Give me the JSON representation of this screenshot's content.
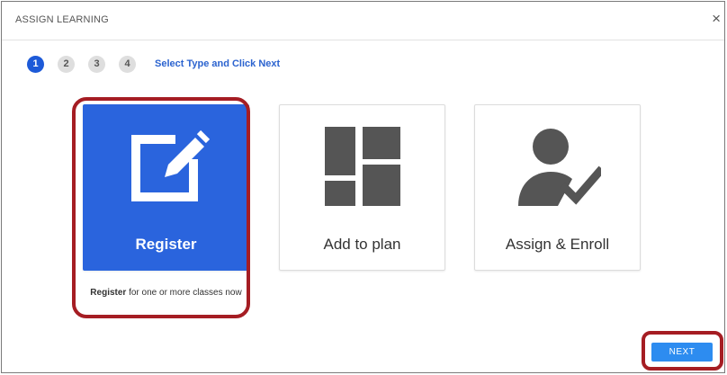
{
  "dialog": {
    "title": "ASSIGN LEARNING",
    "close_symbol": "×"
  },
  "stepper": {
    "steps": [
      "1",
      "2",
      "3",
      "4"
    ],
    "active_step": "1",
    "instruction": "Select Type and Click Next"
  },
  "options": [
    {
      "label": "Register",
      "icon": "edit-icon",
      "selected": true
    },
    {
      "label": "Add to plan",
      "icon": "grid-layout-icon",
      "selected": false
    },
    {
      "label": "Assign & Enroll",
      "icon": "user-check-icon",
      "selected": false
    }
  ],
  "selected_description": {
    "bold": "Register",
    "rest": " for one or more classes now"
  },
  "footer": {
    "next_label": "NEXT"
  },
  "colors": {
    "selected_card": "#2a64dd",
    "active_step": "#1d5ad8",
    "next_button": "#2d8cf0",
    "annotation_outline": "#a51d23",
    "icon_gray": "#555555"
  }
}
